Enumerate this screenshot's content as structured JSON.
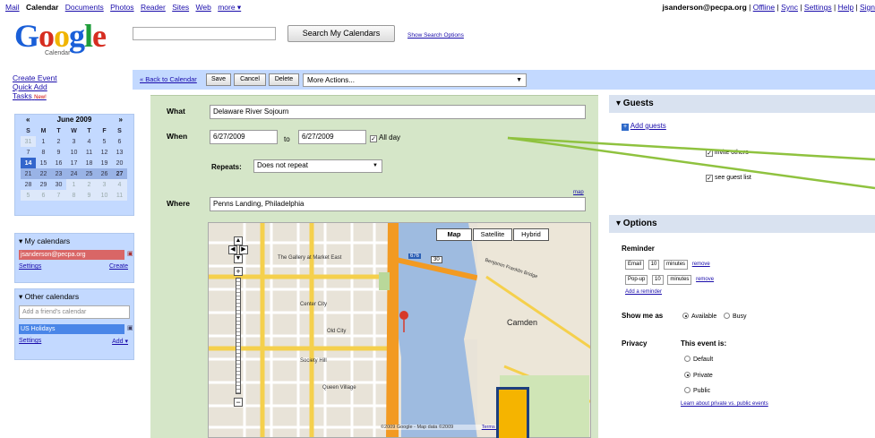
{
  "topbar": {
    "nav": [
      "Mail",
      "Calendar",
      "Documents",
      "Photos",
      "Reader",
      "Sites",
      "Web",
      "more ▾"
    ],
    "current": "Calendar",
    "email": "jsanderson@pecpa.org",
    "links": [
      "Offline",
      "Sync",
      "Settings",
      "Help",
      "Sign"
    ]
  },
  "header": {
    "logo_text": "Google",
    "logo_sub": "Calendar",
    "search_button": "Search My Calendars",
    "search_options": "Show Search Options"
  },
  "left": {
    "create_event": "Create Event",
    "quick_add": "Quick Add",
    "tasks": "Tasks",
    "tasks_badge": "New!",
    "mini_cal": {
      "month": "June 2009",
      "prev": "«",
      "next": "»",
      "dow": [
        "S",
        "M",
        "T",
        "W",
        "T",
        "F",
        "S"
      ],
      "weeks": [
        [
          "31",
          "1",
          "2",
          "3",
          "4",
          "5",
          "6"
        ],
        [
          "7",
          "8",
          "9",
          "10",
          "11",
          "12",
          "13"
        ],
        [
          "14",
          "15",
          "16",
          "17",
          "18",
          "19",
          "20"
        ],
        [
          "21",
          "22",
          "23",
          "24",
          "25",
          "26",
          "27"
        ],
        [
          "28",
          "29",
          "30",
          "1",
          "2",
          "3",
          "4"
        ],
        [
          "5",
          "6",
          "7",
          "8",
          "9",
          "10",
          "11"
        ]
      ]
    },
    "my_calendars": {
      "title": "▾ My calendars",
      "item": "jsanderson@pecpa.org",
      "settings": "Settings",
      "create": "Create"
    },
    "other_calendars": {
      "title": "▾ Other calendars",
      "placeholder": "Add a friend's calendar",
      "item": "US Holidays",
      "settings": "Settings",
      "add": "Add ▾"
    }
  },
  "toolbar": {
    "back": "« Back to Calendar",
    "save": "Save",
    "cancel": "Cancel",
    "delete": "Delete",
    "more_actions": "More Actions..."
  },
  "form": {
    "what_label": "What",
    "what_value": "Delaware River Sojourn",
    "when_label": "When",
    "start_date": "6/27/2009",
    "to_label": "to",
    "end_date": "6/27/2009",
    "all_day": "All day",
    "repeats_label": "Repeats:",
    "repeats_value": "Does not repeat",
    "where_label": "Where",
    "where_value": "Penns Landing, Philadelphia",
    "map_link": "map"
  },
  "map": {
    "types": [
      "Map",
      "Satellite",
      "Hybrid"
    ],
    "labels": {
      "gallery": "The Gallery at Market East",
      "center": "Center City",
      "old_city": "Old City",
      "society_hill": "Society Hill",
      "queen_village": "Queen Village",
      "camden": "Camden",
      "bridge": "Benjamin Franklin Bridge",
      "route_30": "30",
      "route_676": "676"
    },
    "copyright": "©2009 Google - Map data ©2009",
    "terms": "Terms of Use"
  },
  "guests": {
    "title": "▾ Guests",
    "add_guests": "Add guests",
    "invite_others": "invite others",
    "see_guest_list": "see guest list"
  },
  "options": {
    "title": "▾ Options",
    "reminder_label": "Reminder",
    "reminders": [
      {
        "method": "Email",
        "amount": "10",
        "unit": "minutes",
        "remove": "remove"
      },
      {
        "method": "Pop-up",
        "amount": "10",
        "unit": "minutes",
        "remove": "remove"
      }
    ],
    "add_reminder": "Add a reminder",
    "show_me_as": "Show me as",
    "available": "Available",
    "busy": "Busy",
    "privacy": "Privacy",
    "this_event_is": "This event is:",
    "default": "Default",
    "private": "Private",
    "public": "Public",
    "learn_more": "Learn about private vs. public events"
  },
  "colors": {
    "accent_blue": "#c3d9ff",
    "form_green": "#d5e6c8",
    "my_cal_chip": "#d96666",
    "other_cal_chip": "#4a86e8",
    "annotation_line": "#8fc23f",
    "annotation_marker": "#f5b400"
  }
}
